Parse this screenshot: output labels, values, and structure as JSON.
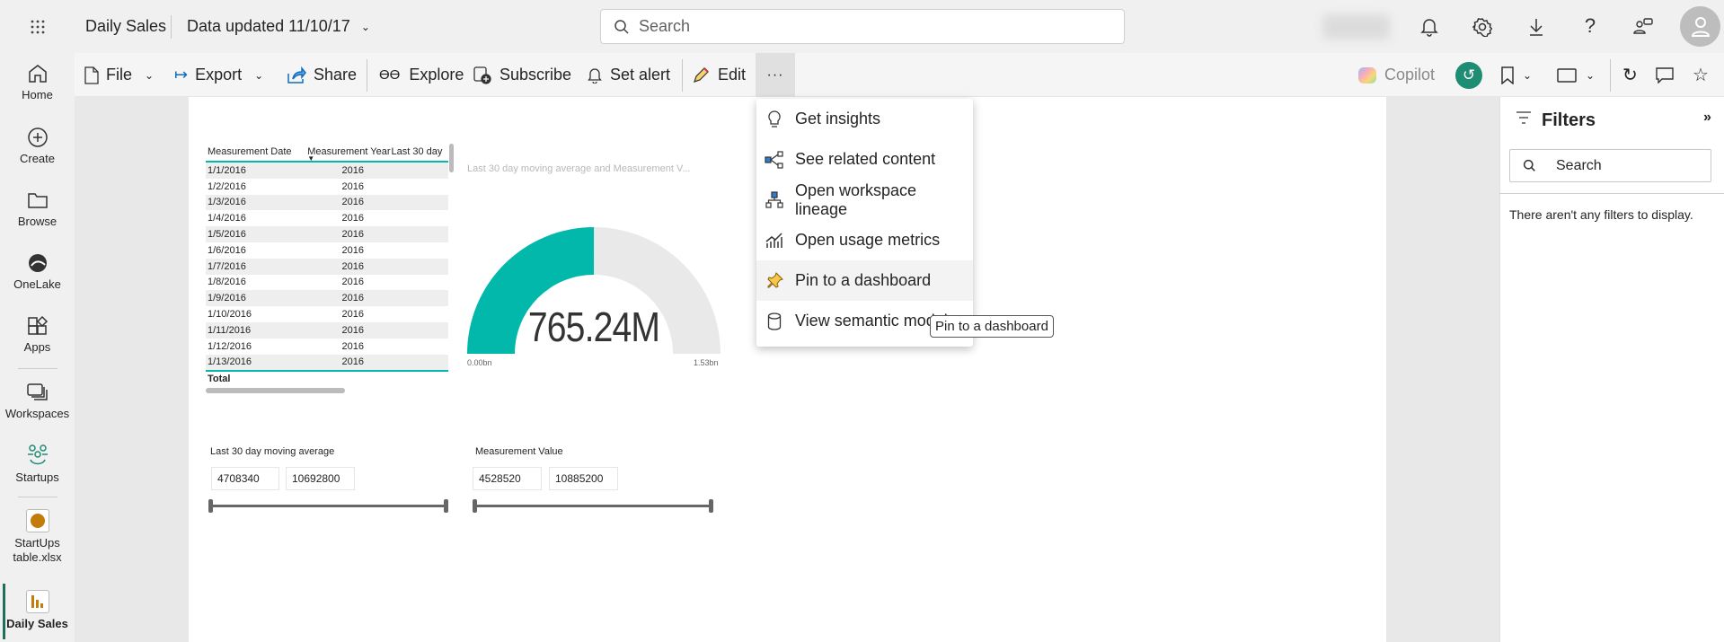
{
  "header": {
    "report_title": "Daily Sales",
    "data_updated": "Data updated 11/10/17",
    "search_placeholder": "Search"
  },
  "toolbar": {
    "file": "File",
    "export": "Export",
    "share": "Share",
    "explore": "Explore",
    "subscribe": "Subscribe",
    "set_alert": "Set alert",
    "edit": "Edit",
    "more": "···",
    "copilot": "Copilot"
  },
  "nav": [
    {
      "label": "Home"
    },
    {
      "label": "Create"
    },
    {
      "label": "Browse"
    },
    {
      "label": "OneLake"
    },
    {
      "label": "Apps"
    },
    {
      "label": "Workspaces"
    },
    {
      "label": "Startups"
    },
    {
      "label": "StartUps table.xlsx"
    },
    {
      "label": "Daily Sales"
    }
  ],
  "table": {
    "columns": [
      "Measurement Date",
      "Measurement Year",
      "Last 30 day"
    ],
    "rows": [
      [
        "1/1/2016",
        "2016"
      ],
      [
        "1/2/2016",
        "2016"
      ],
      [
        "1/3/2016",
        "2016"
      ],
      [
        "1/4/2016",
        "2016"
      ],
      [
        "1/5/2016",
        "2016"
      ],
      [
        "1/6/2016",
        "2016"
      ],
      [
        "1/7/2016",
        "2016"
      ],
      [
        "1/8/2016",
        "2016"
      ],
      [
        "1/9/2016",
        "2016"
      ],
      [
        "1/10/2016",
        "2016"
      ],
      [
        "1/11/2016",
        "2016"
      ],
      [
        "1/12/2016",
        "2016"
      ],
      [
        "1/13/2016",
        "2016"
      ]
    ],
    "total_label": "Total"
  },
  "gauge": {
    "title": "Last 30 day moving average and Measurement V...",
    "value_label": "765.24M",
    "value": 765.24,
    "min": 0,
    "max": 1530,
    "min_label": "0.00bn",
    "max_label": "1.53bn",
    "fill_color": "#01b8aa",
    "track_color": "#e9e9e9"
  },
  "slicers": [
    {
      "title": "Last 30 day moving average",
      "min": "4708340",
      "max": "10692800"
    },
    {
      "title": "Measurement Value",
      "min": "4528520",
      "max": "10885200"
    }
  ],
  "menu": {
    "items": [
      {
        "label": "Get insights"
      },
      {
        "label": "See related content"
      },
      {
        "label": "Open workspace lineage"
      },
      {
        "label": "Open usage metrics"
      },
      {
        "label": "Pin to a dashboard"
      },
      {
        "label": "View semantic model"
      }
    ],
    "tooltip": "Pin to a dashboard"
  },
  "filters": {
    "title": "Filters",
    "search_placeholder": "Search",
    "empty_message": "There aren't any filters to display."
  }
}
